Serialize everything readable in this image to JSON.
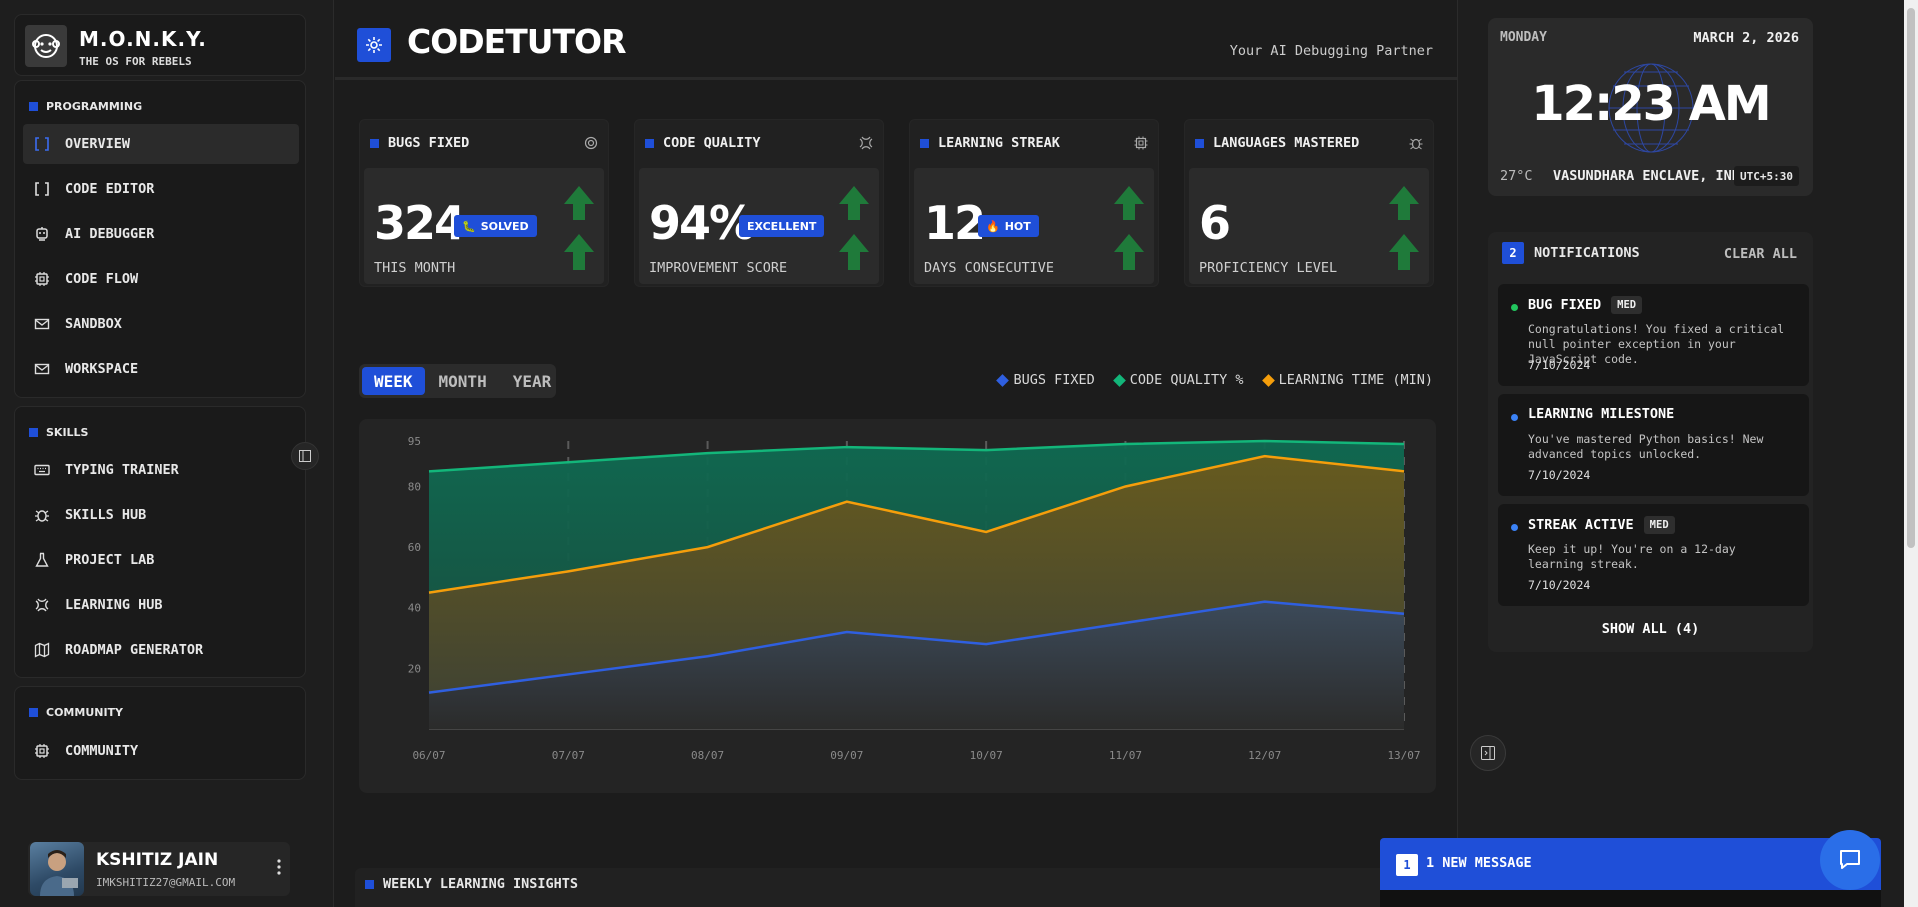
{
  "brand": {
    "name": "M.O.N.K.Y.",
    "tagline": "THE OS FOR REBELS"
  },
  "sidebar": {
    "programming": {
      "title": "PROGRAMMING",
      "items": [
        {
          "label": "OVERVIEW",
          "icon": "brackets-icon",
          "active": true
        },
        {
          "label": "CODE EDITOR",
          "icon": "brackets-icon"
        },
        {
          "label": "AI DEBUGGER",
          "icon": "robot-icon"
        },
        {
          "label": "CODE FLOW",
          "icon": "chip-icon"
        },
        {
          "label": "SANDBOX",
          "icon": "mail-icon"
        },
        {
          "label": "WORKSPACE",
          "icon": "mail-icon"
        }
      ]
    },
    "skills": {
      "title": "SKILLS",
      "items": [
        {
          "label": "TYPING TRAINER",
          "icon": "keyboard-icon"
        },
        {
          "label": "SKILLS HUB",
          "icon": "bug-icon"
        },
        {
          "label": "PROJECT LAB",
          "icon": "flask-icon"
        },
        {
          "label": "LEARNING HUB",
          "icon": "brain-icon"
        },
        {
          "label": "ROADMAP GENERATOR",
          "icon": "map-icon"
        }
      ]
    },
    "community": {
      "title": "COMMUNITY",
      "items": [
        {
          "label": "COMMUNITY",
          "icon": "chip-icon"
        }
      ]
    },
    "user": {
      "name": "KSHITIZ JAIN",
      "email": "IMKSHITIZ27@GMAIL.COM"
    }
  },
  "header": {
    "title": "CODETUTOR",
    "subtitle": "Your AI Debugging Partner"
  },
  "stats": [
    {
      "label": "BUGS FIXED",
      "value": "324",
      "badge": "SOLVED",
      "badge_icon": "bug-icon",
      "caption": "THIS MONTH",
      "icon": "target-icon"
    },
    {
      "label": "CODE QUALITY",
      "value": "94%",
      "badge": "EXCELLENT",
      "badge_icon": "",
      "caption": "IMPROVEMENT SCORE",
      "icon": "brain-icon"
    },
    {
      "label": "LEARNING STREAK",
      "value": "12",
      "badge": "HOT",
      "badge_icon": "fire-icon",
      "caption": "DAYS CONSECUTIVE",
      "icon": "chip-icon"
    },
    {
      "label": "LANGUAGES MASTERED",
      "value": "6",
      "badge": "",
      "badge_icon": "",
      "caption": "PROFICIENCY LEVEL",
      "icon": "bug-icon"
    }
  ],
  "tabs": [
    {
      "label": "WEEK",
      "active": true
    },
    {
      "label": "MONTH"
    },
    {
      "label": "YEAR"
    }
  ],
  "legend": [
    {
      "label": "BUGS FIXED",
      "color": "#2f5fe0"
    },
    {
      "label": "CODE QUALITY %",
      "color": "#13b67a"
    },
    {
      "label": "LEARNING TIME (MIN)",
      "color": "#f59e0b"
    }
  ],
  "chart_data": {
    "type": "area",
    "categories": [
      "06/07",
      "07/07",
      "08/07",
      "09/07",
      "10/07",
      "11/07",
      "12/07",
      "13/07"
    ],
    "y_ticks": [
      20,
      40,
      60,
      80,
      95
    ],
    "ylim": [
      0,
      95
    ],
    "grid": "vertical dashed",
    "legend_position": "top-right",
    "series": [
      {
        "name": "BUGS FIXED",
        "color": "#2f5fe0",
        "values": [
          12,
          18,
          24,
          32,
          28,
          35,
          42,
          38
        ]
      },
      {
        "name": "CODE QUALITY %",
        "color": "#13b67a",
        "values": [
          85,
          88,
          91,
          93,
          92,
          94,
          95,
          94
        ]
      },
      {
        "name": "LEARNING TIME (MIN)",
        "color": "#f59e0b",
        "values": [
          45,
          52,
          60,
          75,
          65,
          80,
          90,
          85
        ]
      }
    ]
  },
  "insights": {
    "title": "WEEKLY LEARNING INSIGHTS"
  },
  "clock": {
    "day": "MONDAY",
    "date": "MARCH 2, 2026",
    "time": "12:23 AM",
    "temp": "27°C",
    "location": "VASUNDHARA ENCLAVE, INDIA",
    "tz": "UTC+5:30"
  },
  "notifications": {
    "count": "2",
    "title": "NOTIFICATIONS",
    "clear_label": "CLEAR ALL",
    "items": [
      {
        "title": "BUG FIXED",
        "tag": "MED",
        "body": "Congratulations! You fixed a critical null pointer exception in your JavaScript code.",
        "date": "7/10/2024",
        "dot": "#22c55e"
      },
      {
        "title": "LEARNING MILESTONE",
        "tag": "",
        "body": "You've mastered Python basics! New advanced topics unlocked.",
        "date": "7/10/2024",
        "dot": "#3b82f6"
      },
      {
        "title": "STREAK ACTIVE",
        "tag": "MED",
        "body": "Keep it up! You're on a 12-day learning streak.",
        "date": "7/10/2024",
        "dot": "#3b82f6"
      }
    ],
    "show_all": "SHOW ALL (4)"
  },
  "new_message": {
    "count": "1",
    "label": "1 NEW MESSAGE"
  }
}
